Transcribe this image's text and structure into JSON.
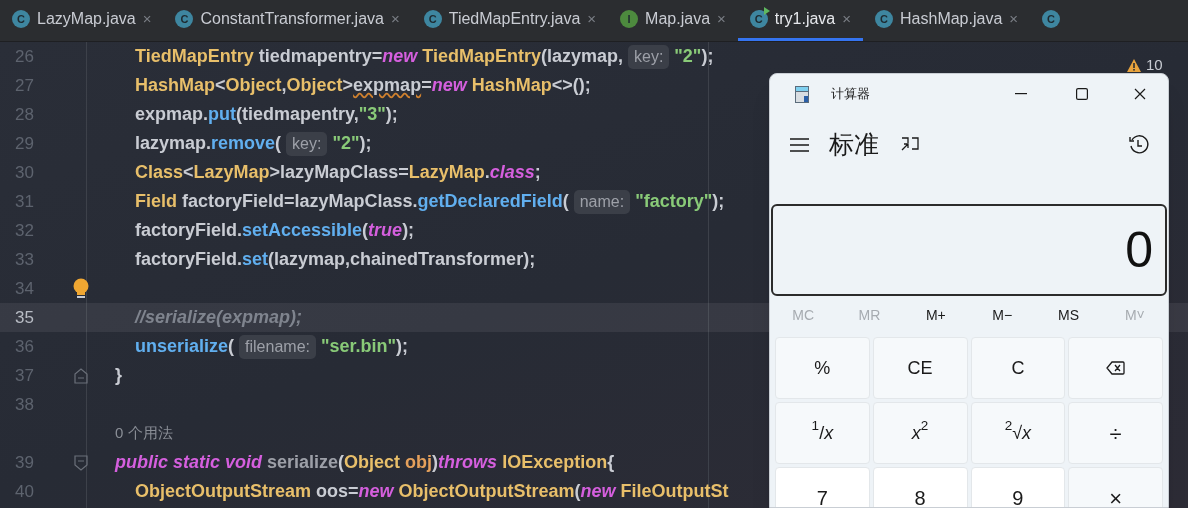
{
  "tabs": [
    {
      "kind": "class",
      "letter": "C",
      "label": "LazyMap.java",
      "close": "×",
      "selected": false,
      "run_marker": false
    },
    {
      "kind": "class",
      "letter": "C",
      "label": "ConstantTransformer.java",
      "close": "×",
      "selected": false,
      "run_marker": false
    },
    {
      "kind": "class",
      "letter": "C",
      "label": "TiedMapEntry.java",
      "close": "×",
      "selected": false,
      "run_marker": false
    },
    {
      "kind": "interface",
      "letter": "I",
      "label": "Map.java",
      "close": "×",
      "selected": false,
      "run_marker": false
    },
    {
      "kind": "class",
      "letter": "C",
      "label": "try1.java",
      "close": "×",
      "selected": true,
      "run_marker": true
    },
    {
      "kind": "class",
      "letter": "C",
      "label": "HashMap.java",
      "close": "×",
      "selected": false,
      "run_marker": false
    },
    {
      "kind": "class",
      "letter": "C",
      "selected": false,
      "run_marker": false
    }
  ],
  "warnings": {
    "count": "10"
  },
  "editor": {
    "lines": [
      {
        "number": "26",
        "kind": "body",
        "bulb": false,
        "fold_start": false,
        "fold_end": false,
        "current": false,
        "tokens": [
          {
            "kind": "type",
            "text": "TiedMapEntry"
          },
          {
            "kind": "plain",
            "text": " tiedmapentry="
          },
          {
            "kind": "keyword",
            "text": "new"
          },
          {
            "kind": "type",
            "text": " TiedMapEntry"
          },
          {
            "kind": "plain",
            "text": "(lazymap,"
          },
          {
            "kind": "hint",
            "text": "key:"
          },
          {
            "kind": "string",
            "text": "\"2\""
          },
          {
            "kind": "plain",
            "text": ");"
          }
        ]
      },
      {
        "number": "27",
        "kind": "body",
        "bulb": false,
        "fold_start": false,
        "fold_end": false,
        "current": false,
        "tokens": [
          {
            "kind": "type",
            "text": "HashMap"
          },
          {
            "kind": "plain",
            "text": "<"
          },
          {
            "kind": "type",
            "text": "Object"
          },
          {
            "kind": "plain",
            "text": ","
          },
          {
            "kind": "type",
            "text": "Object"
          },
          {
            "kind": "plain",
            "text": ">"
          },
          {
            "kind": "warned",
            "text": "expmap"
          },
          {
            "kind": "plain",
            "text": "="
          },
          {
            "kind": "keyword",
            "text": "new"
          },
          {
            "kind": "type",
            "text": " HashMap"
          },
          {
            "kind": "plain",
            "text": "<>();"
          }
        ]
      },
      {
        "number": "28",
        "kind": "body",
        "bulb": false,
        "fold_start": false,
        "fold_end": false,
        "current": false,
        "tokens": [
          {
            "kind": "plain",
            "text": "expmap."
          },
          {
            "kind": "method",
            "text": "put"
          },
          {
            "kind": "plain",
            "text": "(tiedmapentry,"
          },
          {
            "kind": "string",
            "text": "\"3\""
          },
          {
            "kind": "plain",
            "text": ");"
          }
        ]
      },
      {
        "number": "29",
        "kind": "body",
        "bulb": false,
        "fold_start": false,
        "fold_end": false,
        "current": false,
        "tokens": [
          {
            "kind": "plain",
            "text": "lazymap."
          },
          {
            "kind": "method",
            "text": "remove"
          },
          {
            "kind": "plain",
            "text": "("
          },
          {
            "kind": "hint",
            "text": "key:"
          },
          {
            "kind": "string",
            "text": "\"2\""
          },
          {
            "kind": "plain",
            "text": ");"
          }
        ]
      },
      {
        "number": "30",
        "kind": "body",
        "bulb": false,
        "fold_start": false,
        "fold_end": false,
        "current": false,
        "tokens": [
          {
            "kind": "type",
            "text": "Class"
          },
          {
            "kind": "plain",
            "text": "<"
          },
          {
            "kind": "type",
            "text": "LazyMap"
          },
          {
            "kind": "plain",
            "text": ">lazyMapClass="
          },
          {
            "kind": "type",
            "text": "LazyMap"
          },
          {
            "kind": "plain",
            "text": "."
          },
          {
            "kind": "keyword",
            "text": "class"
          },
          {
            "kind": "plain",
            "text": ";"
          }
        ]
      },
      {
        "number": "31",
        "kind": "body",
        "bulb": false,
        "fold_start": false,
        "fold_end": false,
        "current": false,
        "tokens": [
          {
            "kind": "type",
            "text": "Field"
          },
          {
            "kind": "plain",
            "text": " factoryField=lazyMapClass."
          },
          {
            "kind": "method",
            "text": "getDeclaredField"
          },
          {
            "kind": "plain",
            "text": "("
          },
          {
            "kind": "hint",
            "text": "name:"
          },
          {
            "kind": "string",
            "text": "\"factory\""
          },
          {
            "kind": "plain",
            "text": ");"
          }
        ]
      },
      {
        "number": "32",
        "kind": "body",
        "bulb": false,
        "fold_start": false,
        "fold_end": false,
        "current": false,
        "tokens": [
          {
            "kind": "plain",
            "text": "factoryField."
          },
          {
            "kind": "method",
            "text": "setAccessible"
          },
          {
            "kind": "plain",
            "text": "("
          },
          {
            "kind": "keyword",
            "text": "true"
          },
          {
            "kind": "plain",
            "text": ");"
          }
        ]
      },
      {
        "number": "33",
        "kind": "body",
        "bulb": false,
        "fold_start": false,
        "fold_end": false,
        "current": false,
        "tokens": [
          {
            "kind": "plain",
            "text": "factoryField."
          },
          {
            "kind": "method",
            "text": "set"
          },
          {
            "kind": "plain",
            "text": "(lazymap,chainedTransformer);"
          }
        ]
      },
      {
        "number": "34",
        "kind": "body",
        "bulb": true,
        "fold_start": false,
        "fold_end": false,
        "current": false
      },
      {
        "number": "35",
        "kind": "body",
        "bulb": false,
        "fold_start": false,
        "fold_end": false,
        "current": true,
        "tokens": [
          {
            "kind": "comment",
            "text": "//serialize(expmap);"
          }
        ]
      },
      {
        "number": "36",
        "kind": "body",
        "bulb": false,
        "fold_start": false,
        "fold_end": false,
        "current": false,
        "tokens": [
          {
            "kind": "method",
            "text": "unserialize"
          },
          {
            "kind": "plain",
            "text": "("
          },
          {
            "kind": "hint",
            "text": "filename:"
          },
          {
            "kind": "string",
            "text": "\"ser.bin\""
          },
          {
            "kind": "plain",
            "text": ");"
          }
        ]
      },
      {
        "number": "37",
        "kind": "outer",
        "bulb": false,
        "fold_start": false,
        "fold_end": true,
        "current": false,
        "tokens": [
          {
            "kind": "plain",
            "text": "}"
          }
        ]
      },
      {
        "number": "38",
        "kind": "outer",
        "bulb": false,
        "fold_start": false,
        "fold_end": false,
        "current": false
      },
      {
        "kind": "usage",
        "bulb": false,
        "fold_start": false,
        "fold_end": false,
        "tokens": [
          {
            "kind": "usage",
            "text": "0 个用法"
          }
        ]
      },
      {
        "number": "39",
        "kind": "outer",
        "bulb": false,
        "fold_start": true,
        "fold_end": false,
        "current": false,
        "tokens": [
          {
            "kind": "keyword",
            "text": "public static void"
          },
          {
            "kind": "unused",
            "text": " serialize"
          },
          {
            "kind": "plain",
            "text": "("
          },
          {
            "kind": "type",
            "text": "Object"
          },
          {
            "kind": "param",
            "text": " obj"
          },
          {
            "kind": "plain",
            "text": ")"
          },
          {
            "kind": "keyword",
            "text": "throws"
          },
          {
            "kind": "type",
            "text": " IOException"
          },
          {
            "kind": "plain",
            "text": "{"
          }
        ]
      },
      {
        "number": "40",
        "kind": "body",
        "bulb": false,
        "fold_start": false,
        "fold_end": false,
        "current": false,
        "tokens": [
          {
            "kind": "type",
            "text": "ObjectOutputStream"
          },
          {
            "kind": "plain",
            "text": " oos="
          },
          {
            "kind": "keyword",
            "text": "new"
          },
          {
            "kind": "type",
            "text": " ObjectOutputStream"
          },
          {
            "kind": "plain",
            "text": "("
          },
          {
            "kind": "keyword",
            "text": "new"
          },
          {
            "kind": "type",
            "text": " FileOutputSt"
          }
        ]
      }
    ]
  },
  "calculator": {
    "title": "计算器",
    "mode": "标准",
    "display": "0",
    "memory": [
      {
        "label": "MC",
        "disabled": true
      },
      {
        "label": "MR",
        "disabled": true
      },
      {
        "label": "M+",
        "disabled": false
      },
      {
        "label": "M−",
        "disabled": false
      },
      {
        "label": "MS",
        "disabled": false
      },
      {
        "label": "M˅",
        "disabled": true
      }
    ],
    "keys": [
      {
        "kind": "function",
        "label": "%"
      },
      {
        "kind": "function",
        "label": "CE"
      },
      {
        "kind": "function",
        "label": "C"
      },
      {
        "kind": "backspace"
      },
      {
        "kind": "function",
        "label": "$^{1}$/*x*"
      },
      {
        "kind": "function",
        "label": "*x*$^{2}$"
      },
      {
        "kind": "function",
        "label": "$^{2}$√*x*"
      },
      {
        "kind": "operator",
        "label": "÷"
      },
      {
        "kind": "digit",
        "label": "7"
      },
      {
        "kind": "digit",
        "label": "8"
      },
      {
        "kind": "digit",
        "label": "9"
      },
      {
        "kind": "operator",
        "label": "×"
      }
    ]
  }
}
